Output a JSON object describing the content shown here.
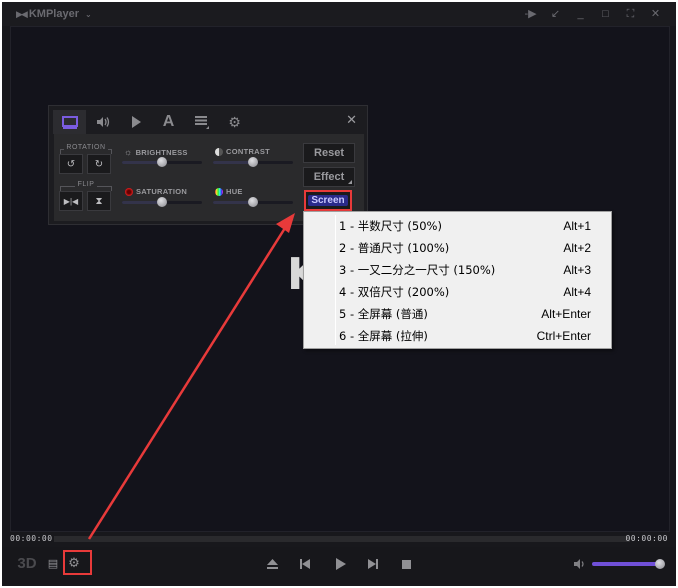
{
  "window": {
    "title": "KMPlayer",
    "logo_glyph": "▶◀",
    "menu_chevron": "⌄",
    "buttons": [
      {
        "name": "pin-button",
        "icon": "pin-icon",
        "glyph": "-▶"
      },
      {
        "name": "mini-mode-button",
        "icon": "arrow-down-left-icon",
        "glyph": "↙"
      },
      {
        "name": "minimize-button",
        "icon": "minimize-icon",
        "glyph": "_"
      },
      {
        "name": "maximize-button",
        "icon": "maximize-icon",
        "glyph": "□"
      },
      {
        "name": "fullscreen-button",
        "icon": "fullscreen-icon",
        "glyph": "⛶"
      },
      {
        "name": "close-button",
        "icon": "close-icon",
        "glyph": "✕"
      }
    ]
  },
  "video": {
    "logo_partial": "K"
  },
  "panel": {
    "tabs": [
      {
        "name": "screen",
        "icon": "monitor-icon",
        "glyph": "▭",
        "active": true
      },
      {
        "name": "audio",
        "icon": "speaker-icon",
        "glyph": "🔊",
        "active": false
      },
      {
        "name": "playback",
        "icon": "play-icon",
        "glyph": "▶",
        "active": false
      },
      {
        "name": "subtitle",
        "icon": "text-icon",
        "glyph": "A",
        "active": false
      },
      {
        "name": "playlist",
        "icon": "list-icon",
        "glyph": "≡",
        "active": false
      },
      {
        "name": "settings",
        "icon": "gear-icon",
        "glyph": "⚙",
        "active": false
      }
    ],
    "close_glyph": "✕",
    "rotation_label": "ROTATION",
    "flip_label": "FLIP",
    "rotate_ccw_glyph": "↺",
    "rotate_cw_glyph": "↻",
    "flip_h_glyph": "▶|◀",
    "flip_v_glyph": "⧗",
    "adjustments": [
      {
        "name": "brightness",
        "label": "BRIGHTNESS",
        "value_fraction": 0.5
      },
      {
        "name": "contrast",
        "label": "CONTRAST",
        "value_fraction": 0.5
      },
      {
        "name": "saturation",
        "label": "SATURATION",
        "value_fraction": 0.5
      },
      {
        "name": "hue",
        "label": "HUE",
        "value_fraction": 0.5
      }
    ],
    "reset_label": "Reset",
    "effect_label": "Effect",
    "screen_label": "Screen"
  },
  "screen_menu": {
    "items": [
      {
        "label": "1 - 半数尺寸 (50%)",
        "shortcut": "Alt+1"
      },
      {
        "label": "2 - 普通尺寸 (100%)",
        "shortcut": "Alt+2"
      },
      {
        "label": "3 - 一又二分之一尺寸 (150%)",
        "shortcut": "Alt+3"
      },
      {
        "label": "4 - 双倍尺寸 (200%)",
        "shortcut": "Alt+4"
      },
      {
        "label": "5 - 全屏幕 (普通)",
        "shortcut": "Alt+Enter"
      },
      {
        "label": "6 - 全屏幕 (拉伸)",
        "shortcut": "Ctrl+Enter"
      }
    ]
  },
  "playback": {
    "current_time": "00:00:00",
    "total_time": "00:00:00",
    "progress_fraction": 0,
    "volume_fraction": 1.0,
    "three_d_label": "3D",
    "playlist_glyph": "▤",
    "settings_glyph": "⚙",
    "eject_glyph": "⏏",
    "prev_glyph": "⏮",
    "play_glyph": "▶",
    "next_glyph": "⏭",
    "stop_glyph": "■",
    "volume_glyph": "🔈"
  },
  "annotation": {
    "highlight_color": "#e83a3a"
  }
}
